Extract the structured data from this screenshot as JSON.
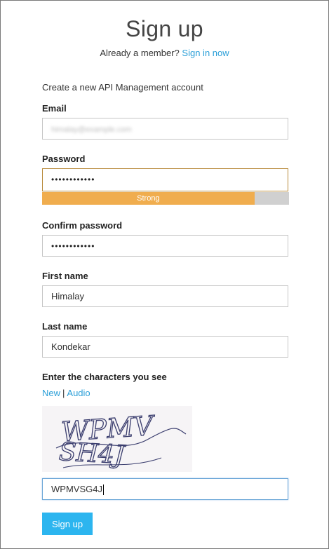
{
  "page": {
    "title": "Sign up",
    "already_member_text": "Already a member?",
    "sign_in_link": "Sign in now",
    "intro": "Create a new API Management account"
  },
  "form": {
    "email": {
      "label": "Email",
      "value": "himalay@example.com"
    },
    "password": {
      "label": "Password",
      "value": "••••••••••••",
      "strength_label": "Strong",
      "strength_fraction": 0.86,
      "strength_color": "#f0ad4e"
    },
    "confirm_password": {
      "label": "Confirm password",
      "value": "••••••••••••"
    },
    "first_name": {
      "label": "First name",
      "value": "Himalay"
    },
    "last_name": {
      "label": "Last name",
      "value": "Kondekar"
    },
    "captcha": {
      "label": "Enter the characters you see",
      "new_link": "New",
      "separator": "|",
      "audio_link": "Audio",
      "image_text_line1": "WPMV",
      "image_text_line2": "SH4J",
      "value": "WPMVSG4J"
    }
  },
  "actions": {
    "submit_label": "Sign up"
  },
  "colors": {
    "link": "#2b9fd8",
    "button": "#2cb5ef"
  }
}
